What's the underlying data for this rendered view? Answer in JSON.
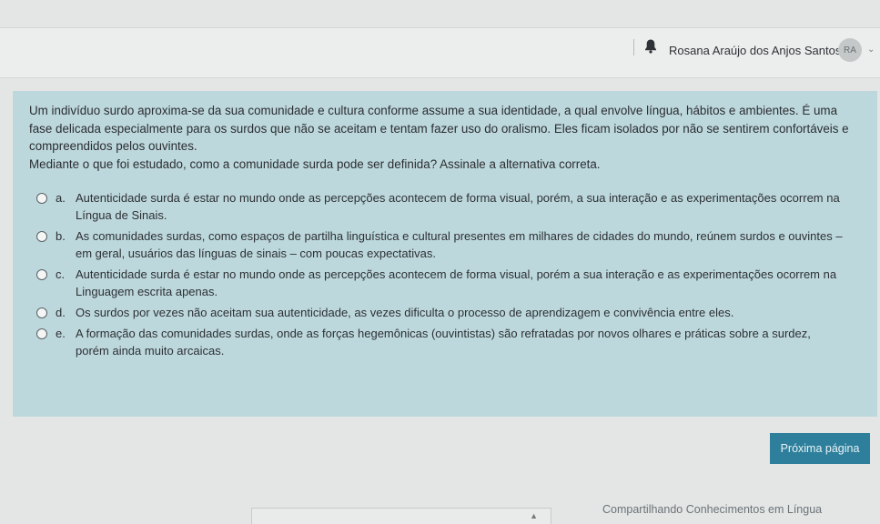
{
  "header": {
    "user_name": "Rosana Araújo dos Anjos Santos",
    "avatar_initials": "RA"
  },
  "question": {
    "text": "Um indivíduo surdo aproxima-se da sua comunidade e cultura conforme assume a sua identidade, a qual envolve língua, hábitos e ambientes. É uma fase delicada especialmente para os surdos que não se aceitam e tentam fazer uso do oralismo. Eles ficam isolados por não se sentirem confortáveis e compreendidos pelos ouvintes.",
    "prompt": "Mediante o que foi estudado, como a comunidade surda pode ser definida? Assinale a alternativa correta.",
    "options": [
      {
        "letter": "a.",
        "text": "Autenticidade surda é estar no mundo onde as percepções acontecem de forma visual, porém, a sua interação e as experimentações ocorrem na Língua de Sinais."
      },
      {
        "letter": "b.",
        "text": "As comunidades surdas, como espaços de partilha linguística e cultural presentes em milhares de cidades do mundo, reúnem surdos e ouvintes – em geral, usuários das línguas de sinais – com poucas expectativas."
      },
      {
        "letter": "c.",
        "text": "Autenticidade surda é estar no mundo onde as percepções acontecem de forma visual, porém a sua interação e as experimentações ocorrem na Linguagem escrita apenas."
      },
      {
        "letter": "d.",
        "text": "Os surdos por vezes não aceitam sua autenticidade, as vezes dificulta o processo de aprendizagem e convivência entre eles."
      },
      {
        "letter": "e.",
        "text": "A formação das comunidades surdas, onde as forças hegemônicas (ouvintistas) são refratadas por novos olhares e práticas sobre a surdez, porém ainda muito arcaicas."
      }
    ]
  },
  "navigation": {
    "next_page_label": "Próxima página",
    "next_activity_link": "Compartilhando Conhecimentos em Língua"
  },
  "colors": {
    "panel_bg": "#bdd8dc",
    "button_bg": "#2d7f9c"
  }
}
